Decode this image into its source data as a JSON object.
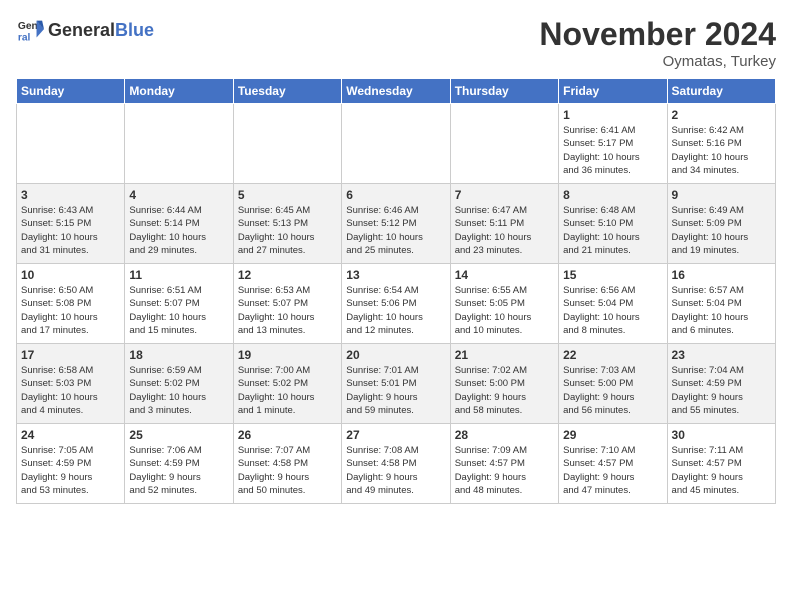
{
  "header": {
    "logo_general": "General",
    "logo_blue": "Blue",
    "month_title": "November 2024",
    "subtitle": "Oymatas, Turkey"
  },
  "weekdays": [
    "Sunday",
    "Monday",
    "Tuesday",
    "Wednesday",
    "Thursday",
    "Friday",
    "Saturday"
  ],
  "weeks": [
    [
      {
        "day": "",
        "info": ""
      },
      {
        "day": "",
        "info": ""
      },
      {
        "day": "",
        "info": ""
      },
      {
        "day": "",
        "info": ""
      },
      {
        "day": "",
        "info": ""
      },
      {
        "day": "1",
        "info": "Sunrise: 6:41 AM\nSunset: 5:17 PM\nDaylight: 10 hours\nand 36 minutes."
      },
      {
        "day": "2",
        "info": "Sunrise: 6:42 AM\nSunset: 5:16 PM\nDaylight: 10 hours\nand 34 minutes."
      }
    ],
    [
      {
        "day": "3",
        "info": "Sunrise: 6:43 AM\nSunset: 5:15 PM\nDaylight: 10 hours\nand 31 minutes."
      },
      {
        "day": "4",
        "info": "Sunrise: 6:44 AM\nSunset: 5:14 PM\nDaylight: 10 hours\nand 29 minutes."
      },
      {
        "day": "5",
        "info": "Sunrise: 6:45 AM\nSunset: 5:13 PM\nDaylight: 10 hours\nand 27 minutes."
      },
      {
        "day": "6",
        "info": "Sunrise: 6:46 AM\nSunset: 5:12 PM\nDaylight: 10 hours\nand 25 minutes."
      },
      {
        "day": "7",
        "info": "Sunrise: 6:47 AM\nSunset: 5:11 PM\nDaylight: 10 hours\nand 23 minutes."
      },
      {
        "day": "8",
        "info": "Sunrise: 6:48 AM\nSunset: 5:10 PM\nDaylight: 10 hours\nand 21 minutes."
      },
      {
        "day": "9",
        "info": "Sunrise: 6:49 AM\nSunset: 5:09 PM\nDaylight: 10 hours\nand 19 minutes."
      }
    ],
    [
      {
        "day": "10",
        "info": "Sunrise: 6:50 AM\nSunset: 5:08 PM\nDaylight: 10 hours\nand 17 minutes."
      },
      {
        "day": "11",
        "info": "Sunrise: 6:51 AM\nSunset: 5:07 PM\nDaylight: 10 hours\nand 15 minutes."
      },
      {
        "day": "12",
        "info": "Sunrise: 6:53 AM\nSunset: 5:07 PM\nDaylight: 10 hours\nand 13 minutes."
      },
      {
        "day": "13",
        "info": "Sunrise: 6:54 AM\nSunset: 5:06 PM\nDaylight: 10 hours\nand 12 minutes."
      },
      {
        "day": "14",
        "info": "Sunrise: 6:55 AM\nSunset: 5:05 PM\nDaylight: 10 hours\nand 10 minutes."
      },
      {
        "day": "15",
        "info": "Sunrise: 6:56 AM\nSunset: 5:04 PM\nDaylight: 10 hours\nand 8 minutes."
      },
      {
        "day": "16",
        "info": "Sunrise: 6:57 AM\nSunset: 5:04 PM\nDaylight: 10 hours\nand 6 minutes."
      }
    ],
    [
      {
        "day": "17",
        "info": "Sunrise: 6:58 AM\nSunset: 5:03 PM\nDaylight: 10 hours\nand 4 minutes."
      },
      {
        "day": "18",
        "info": "Sunrise: 6:59 AM\nSunset: 5:02 PM\nDaylight: 10 hours\nand 3 minutes."
      },
      {
        "day": "19",
        "info": "Sunrise: 7:00 AM\nSunset: 5:02 PM\nDaylight: 10 hours\nand 1 minute."
      },
      {
        "day": "20",
        "info": "Sunrise: 7:01 AM\nSunset: 5:01 PM\nDaylight: 9 hours\nand 59 minutes."
      },
      {
        "day": "21",
        "info": "Sunrise: 7:02 AM\nSunset: 5:00 PM\nDaylight: 9 hours\nand 58 minutes."
      },
      {
        "day": "22",
        "info": "Sunrise: 7:03 AM\nSunset: 5:00 PM\nDaylight: 9 hours\nand 56 minutes."
      },
      {
        "day": "23",
        "info": "Sunrise: 7:04 AM\nSunset: 4:59 PM\nDaylight: 9 hours\nand 55 minutes."
      }
    ],
    [
      {
        "day": "24",
        "info": "Sunrise: 7:05 AM\nSunset: 4:59 PM\nDaylight: 9 hours\nand 53 minutes."
      },
      {
        "day": "25",
        "info": "Sunrise: 7:06 AM\nSunset: 4:59 PM\nDaylight: 9 hours\nand 52 minutes."
      },
      {
        "day": "26",
        "info": "Sunrise: 7:07 AM\nSunset: 4:58 PM\nDaylight: 9 hours\nand 50 minutes."
      },
      {
        "day": "27",
        "info": "Sunrise: 7:08 AM\nSunset: 4:58 PM\nDaylight: 9 hours\nand 49 minutes."
      },
      {
        "day": "28",
        "info": "Sunrise: 7:09 AM\nSunset: 4:57 PM\nDaylight: 9 hours\nand 48 minutes."
      },
      {
        "day": "29",
        "info": "Sunrise: 7:10 AM\nSunset: 4:57 PM\nDaylight: 9 hours\nand 47 minutes."
      },
      {
        "day": "30",
        "info": "Sunrise: 7:11 AM\nSunset: 4:57 PM\nDaylight: 9 hours\nand 45 minutes."
      }
    ]
  ]
}
